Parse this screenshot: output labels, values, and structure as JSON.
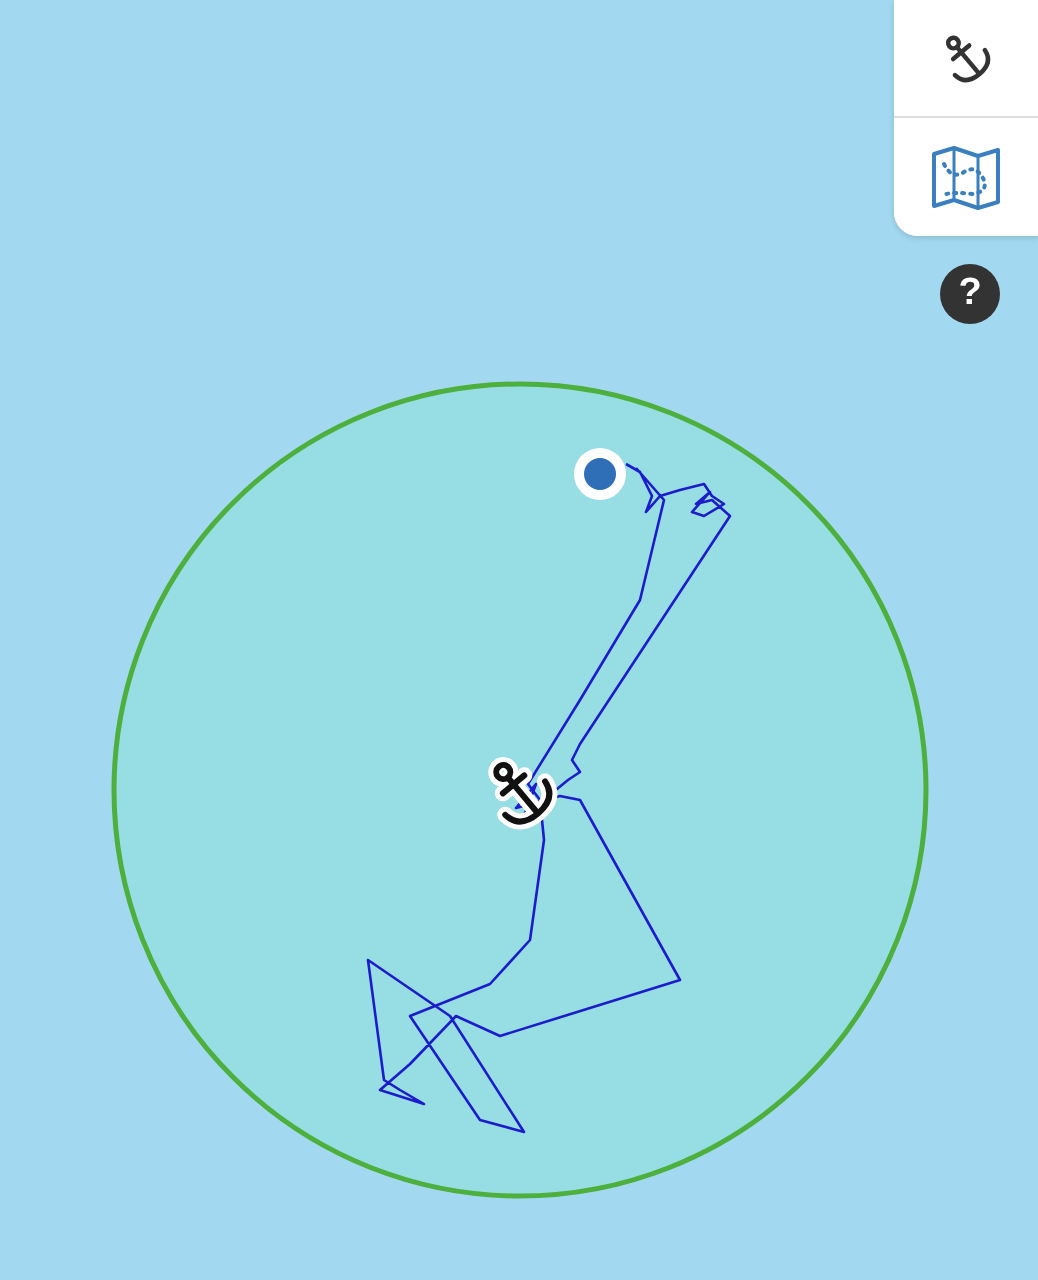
{
  "toolbar": {
    "buttons": [
      {
        "kind": "anchor"
      },
      {
        "kind": "map"
      }
    ]
  },
  "help": {
    "label": "?"
  },
  "overlay": {
    "kind": "anchor-watch"
  }
}
